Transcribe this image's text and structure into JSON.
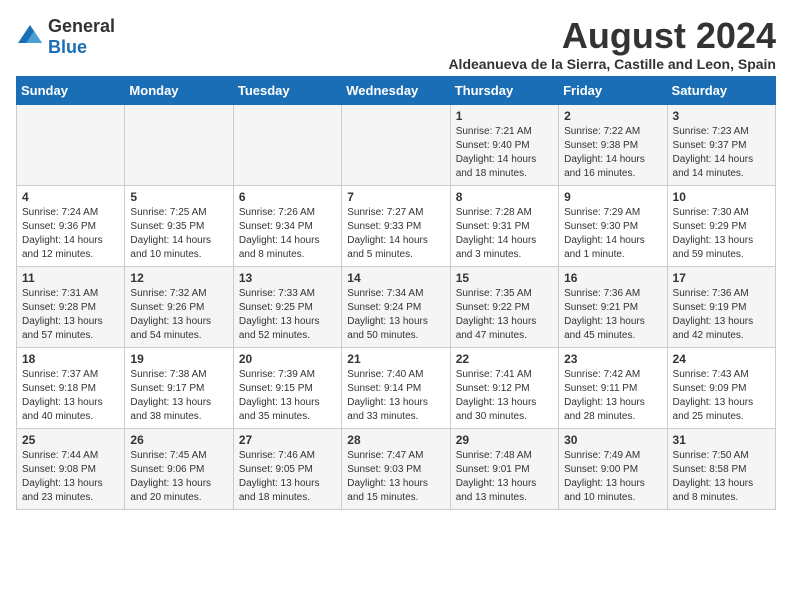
{
  "logo": {
    "general": "General",
    "blue": "Blue"
  },
  "title": {
    "month_year": "August 2024",
    "location": "Aldeanueva de la Sierra, Castille and Leon, Spain"
  },
  "days_of_week": [
    "Sunday",
    "Monday",
    "Tuesday",
    "Wednesday",
    "Thursday",
    "Friday",
    "Saturday"
  ],
  "weeks": [
    [
      {
        "day": "",
        "info": ""
      },
      {
        "day": "",
        "info": ""
      },
      {
        "day": "",
        "info": ""
      },
      {
        "day": "",
        "info": ""
      },
      {
        "day": "1",
        "info": "Sunrise: 7:21 AM\nSunset: 9:40 PM\nDaylight: 14 hours and 18 minutes."
      },
      {
        "day": "2",
        "info": "Sunrise: 7:22 AM\nSunset: 9:38 PM\nDaylight: 14 hours and 16 minutes."
      },
      {
        "day": "3",
        "info": "Sunrise: 7:23 AM\nSunset: 9:37 PM\nDaylight: 14 hours and 14 minutes."
      }
    ],
    [
      {
        "day": "4",
        "info": "Sunrise: 7:24 AM\nSunset: 9:36 PM\nDaylight: 14 hours and 12 minutes."
      },
      {
        "day": "5",
        "info": "Sunrise: 7:25 AM\nSunset: 9:35 PM\nDaylight: 14 hours and 10 minutes."
      },
      {
        "day": "6",
        "info": "Sunrise: 7:26 AM\nSunset: 9:34 PM\nDaylight: 14 hours and 8 minutes."
      },
      {
        "day": "7",
        "info": "Sunrise: 7:27 AM\nSunset: 9:33 PM\nDaylight: 14 hours and 5 minutes."
      },
      {
        "day": "8",
        "info": "Sunrise: 7:28 AM\nSunset: 9:31 PM\nDaylight: 14 hours and 3 minutes."
      },
      {
        "day": "9",
        "info": "Sunrise: 7:29 AM\nSunset: 9:30 PM\nDaylight: 14 hours and 1 minute."
      },
      {
        "day": "10",
        "info": "Sunrise: 7:30 AM\nSunset: 9:29 PM\nDaylight: 13 hours and 59 minutes."
      }
    ],
    [
      {
        "day": "11",
        "info": "Sunrise: 7:31 AM\nSunset: 9:28 PM\nDaylight: 13 hours and 57 minutes."
      },
      {
        "day": "12",
        "info": "Sunrise: 7:32 AM\nSunset: 9:26 PM\nDaylight: 13 hours and 54 minutes."
      },
      {
        "day": "13",
        "info": "Sunrise: 7:33 AM\nSunset: 9:25 PM\nDaylight: 13 hours and 52 minutes."
      },
      {
        "day": "14",
        "info": "Sunrise: 7:34 AM\nSunset: 9:24 PM\nDaylight: 13 hours and 50 minutes."
      },
      {
        "day": "15",
        "info": "Sunrise: 7:35 AM\nSunset: 9:22 PM\nDaylight: 13 hours and 47 minutes."
      },
      {
        "day": "16",
        "info": "Sunrise: 7:36 AM\nSunset: 9:21 PM\nDaylight: 13 hours and 45 minutes."
      },
      {
        "day": "17",
        "info": "Sunrise: 7:36 AM\nSunset: 9:19 PM\nDaylight: 13 hours and 42 minutes."
      }
    ],
    [
      {
        "day": "18",
        "info": "Sunrise: 7:37 AM\nSunset: 9:18 PM\nDaylight: 13 hours and 40 minutes."
      },
      {
        "day": "19",
        "info": "Sunrise: 7:38 AM\nSunset: 9:17 PM\nDaylight: 13 hours and 38 minutes."
      },
      {
        "day": "20",
        "info": "Sunrise: 7:39 AM\nSunset: 9:15 PM\nDaylight: 13 hours and 35 minutes."
      },
      {
        "day": "21",
        "info": "Sunrise: 7:40 AM\nSunset: 9:14 PM\nDaylight: 13 hours and 33 minutes."
      },
      {
        "day": "22",
        "info": "Sunrise: 7:41 AM\nSunset: 9:12 PM\nDaylight: 13 hours and 30 minutes."
      },
      {
        "day": "23",
        "info": "Sunrise: 7:42 AM\nSunset: 9:11 PM\nDaylight: 13 hours and 28 minutes."
      },
      {
        "day": "24",
        "info": "Sunrise: 7:43 AM\nSunset: 9:09 PM\nDaylight: 13 hours and 25 minutes."
      }
    ],
    [
      {
        "day": "25",
        "info": "Sunrise: 7:44 AM\nSunset: 9:08 PM\nDaylight: 13 hours and 23 minutes."
      },
      {
        "day": "26",
        "info": "Sunrise: 7:45 AM\nSunset: 9:06 PM\nDaylight: 13 hours and 20 minutes."
      },
      {
        "day": "27",
        "info": "Sunrise: 7:46 AM\nSunset: 9:05 PM\nDaylight: 13 hours and 18 minutes."
      },
      {
        "day": "28",
        "info": "Sunrise: 7:47 AM\nSunset: 9:03 PM\nDaylight: 13 hours and 15 minutes."
      },
      {
        "day": "29",
        "info": "Sunrise: 7:48 AM\nSunset: 9:01 PM\nDaylight: 13 hours and 13 minutes."
      },
      {
        "day": "30",
        "info": "Sunrise: 7:49 AM\nSunset: 9:00 PM\nDaylight: 13 hours and 10 minutes."
      },
      {
        "day": "31",
        "info": "Sunrise: 7:50 AM\nSunset: 8:58 PM\nDaylight: 13 hours and 8 minutes."
      }
    ]
  ]
}
